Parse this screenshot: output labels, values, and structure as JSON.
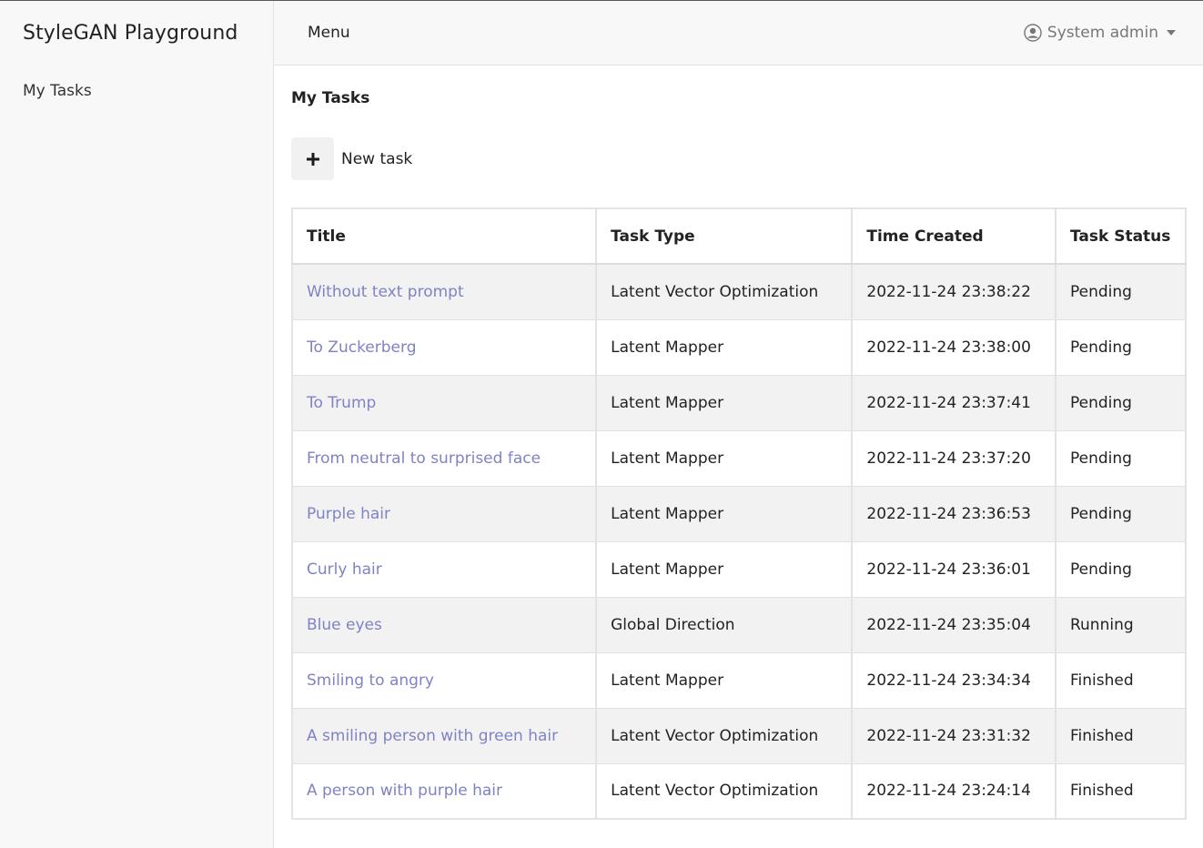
{
  "sidebar": {
    "brand": "StyleGAN Playground",
    "items": [
      {
        "label": "My Tasks"
      }
    ]
  },
  "topbar": {
    "menu_label": "Menu",
    "user_label": "System admin"
  },
  "page": {
    "title": "My Tasks",
    "new_task_label": "New task"
  },
  "table": {
    "columns": [
      "Title",
      "Task Type",
      "Time Created",
      "Task Status"
    ],
    "rows": [
      {
        "title": "Without text prompt",
        "type": "Latent Vector Optimization",
        "created": "2022-11-24 23:38:22",
        "status": "Pending"
      },
      {
        "title": "To Zuckerberg",
        "type": "Latent Mapper",
        "created": "2022-11-24 23:38:00",
        "status": "Pending"
      },
      {
        "title": "To Trump",
        "type": "Latent Mapper",
        "created": "2022-11-24 23:37:41",
        "status": "Pending"
      },
      {
        "title": "From neutral to surprised face",
        "type": "Latent Mapper",
        "created": "2022-11-24 23:37:20",
        "status": "Pending"
      },
      {
        "title": "Purple hair",
        "type": "Latent Mapper",
        "created": "2022-11-24 23:36:53",
        "status": "Pending"
      },
      {
        "title": "Curly hair",
        "type": "Latent Mapper",
        "created": "2022-11-24 23:36:01",
        "status": "Pending"
      },
      {
        "title": "Blue eyes",
        "type": "Global Direction",
        "created": "2022-11-24 23:35:04",
        "status": "Running"
      },
      {
        "title": "Smiling to angry",
        "type": "Latent Mapper",
        "created": "2022-11-24 23:34:34",
        "status": "Finished"
      },
      {
        "title": "A smiling person with green hair",
        "type": "Latent Vector Optimization",
        "created": "2022-11-24 23:31:32",
        "status": "Finished"
      },
      {
        "title": "A person with purple hair",
        "type": "Latent Vector Optimization",
        "created": "2022-11-24 23:24:14",
        "status": "Finished"
      }
    ]
  },
  "colors": {
    "link": "#7f83c4",
    "stripe": "#f2f2f2",
    "sidebar_bg": "#f8f8f8"
  }
}
